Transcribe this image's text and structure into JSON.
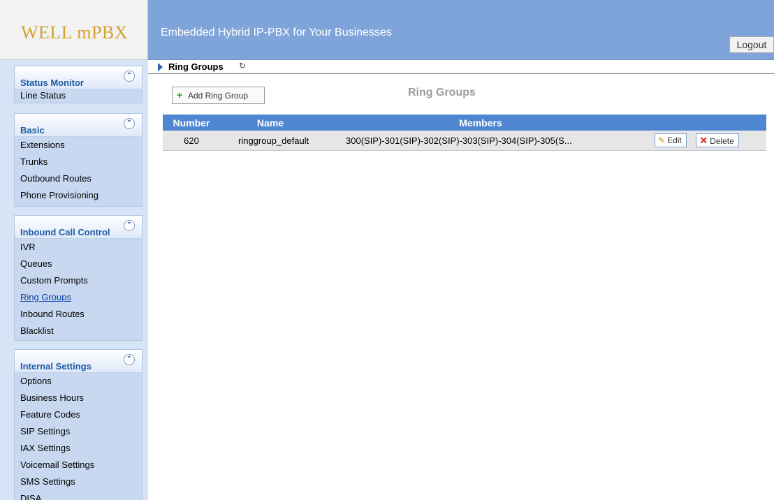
{
  "header": {
    "logo": "WELL mPBX",
    "tagline": "Embedded Hybrid IP-PBX for Your Businesses",
    "logout_label": "Logout"
  },
  "sidebar": {
    "collapse_glyph": "⌃",
    "panels": [
      {
        "title": "Status Monitor",
        "items": [
          "Line Status"
        ]
      },
      {
        "title": "Basic",
        "items": [
          "Extensions",
          "Trunks",
          "Outbound Routes",
          "Phone Provisioning"
        ]
      },
      {
        "title": "Inbound Call Control",
        "items": [
          "IVR",
          "Queues",
          "Custom Prompts",
          "Ring Groups",
          "Inbound Routes",
          "Blacklist"
        ]
      },
      {
        "title": "Internal Settings",
        "items": [
          "Options",
          "Business Hours",
          "Feature Codes",
          "SIP Settings",
          "IAX Settings",
          "Voicemail Settings",
          "SMS Settings",
          "DISA"
        ]
      }
    ],
    "active_item": "Ring Groups"
  },
  "breadcrumb": {
    "label": "Ring Groups",
    "refresh_icon": "refresh-icon"
  },
  "toolbar": {
    "add_label": "Add Ring Group",
    "add_icon": "plus-icon"
  },
  "page_title": "Ring Groups",
  "table": {
    "columns": [
      "Number",
      "Name",
      "Members",
      ""
    ],
    "rows": [
      {
        "number": "620",
        "name": "ringgroup_default",
        "members": "300(SIP)-301(SIP)-302(SIP)-303(SIP)-304(SIP)-305(S...",
        "edit_label": "Edit",
        "delete_label": "Delete"
      }
    ]
  },
  "colors": {
    "header_band": "#7fa4d9",
    "logo": "#d4a12a",
    "sidebar_bg": "#d7e4f6",
    "panel_title": "#1f5aa6",
    "table_header": "#4f86d1",
    "row_bg": "#e6e6e6"
  }
}
